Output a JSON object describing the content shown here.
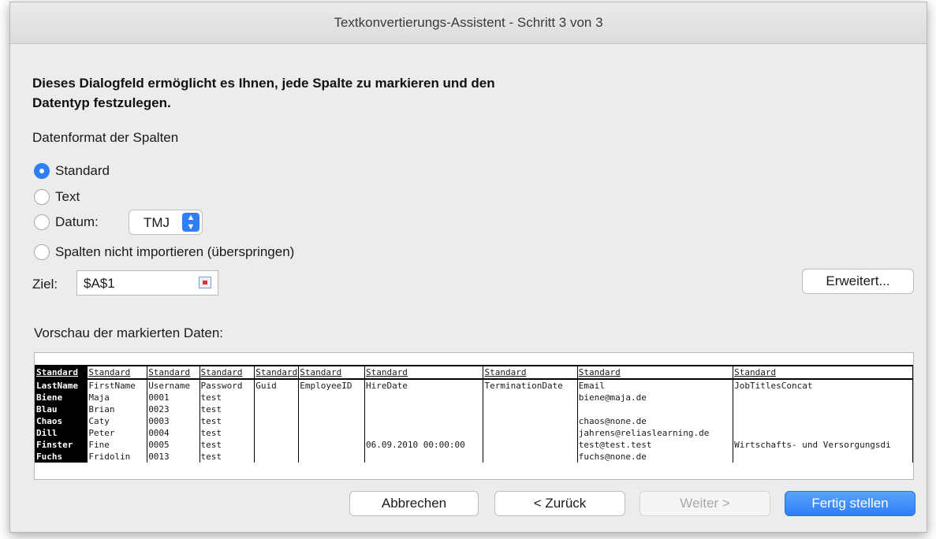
{
  "window": {
    "title": "Textkonvertierungs-Assistent - Schritt 3 von 3"
  },
  "heading": "Dieses Dialogfeld ermöglicht es Ihnen, jede Spalte zu markieren und den Datentyp festzulegen.",
  "format_group_label": "Datenformat der Spalten",
  "radios": {
    "standard": "Standard",
    "text": "Text",
    "datum": "Datum:",
    "skip": "Spalten nicht importieren (überspringen)"
  },
  "selected_format": "standard",
  "datum_select": {
    "value": "TMJ"
  },
  "ziel": {
    "label": "Ziel:",
    "value": "$A$1"
  },
  "advanced_button": "Erweitert...",
  "preview": {
    "label": "Vorschau der markierten Daten:",
    "headers": [
      "Standard",
      "Standard",
      "Standard",
      "Standard",
      "Standard",
      "Standard",
      "Standard",
      "Standard",
      "Standard",
      "Standard"
    ],
    "rows": [
      [
        "LastName",
        "FirstName",
        "Username",
        "Password",
        "Guid",
        "EmployeeID",
        "HireDate",
        "TerminationDate",
        "Email",
        "JobTitlesConcat"
      ],
      [
        "Biene",
        "Maja",
        "0001",
        "test",
        "",
        "",
        "",
        "",
        "biene@maja.de",
        ""
      ],
      [
        "Blau",
        "Brian",
        "0023",
        "test",
        "",
        "",
        "",
        "",
        "",
        ""
      ],
      [
        "Chaos",
        "Caty",
        "0003",
        "test",
        "",
        "",
        "",
        "",
        "chaos@none.de",
        ""
      ],
      [
        "Dill",
        "Peter",
        "0004",
        "test",
        "",
        "",
        "",
        "",
        "jahrens@reliaslearning.de",
        ""
      ],
      [
        "Finster",
        "Fine",
        "0005",
        "test",
        "",
        "",
        "06.09.2010 00:00:00",
        "",
        "test@test.test",
        "Wirtschafts- und Versorgungsdi"
      ],
      [
        "Fuchs",
        "Fridolin",
        "0013",
        "test",
        "",
        "",
        "",
        "",
        "fuchs@none.de",
        ""
      ]
    ]
  },
  "buttons": {
    "cancel": "Abbrechen",
    "back": "< Zurück",
    "next": "Weiter >",
    "finish": "Fertig stellen"
  },
  "colors": {
    "accent": "#2f7ef6"
  }
}
